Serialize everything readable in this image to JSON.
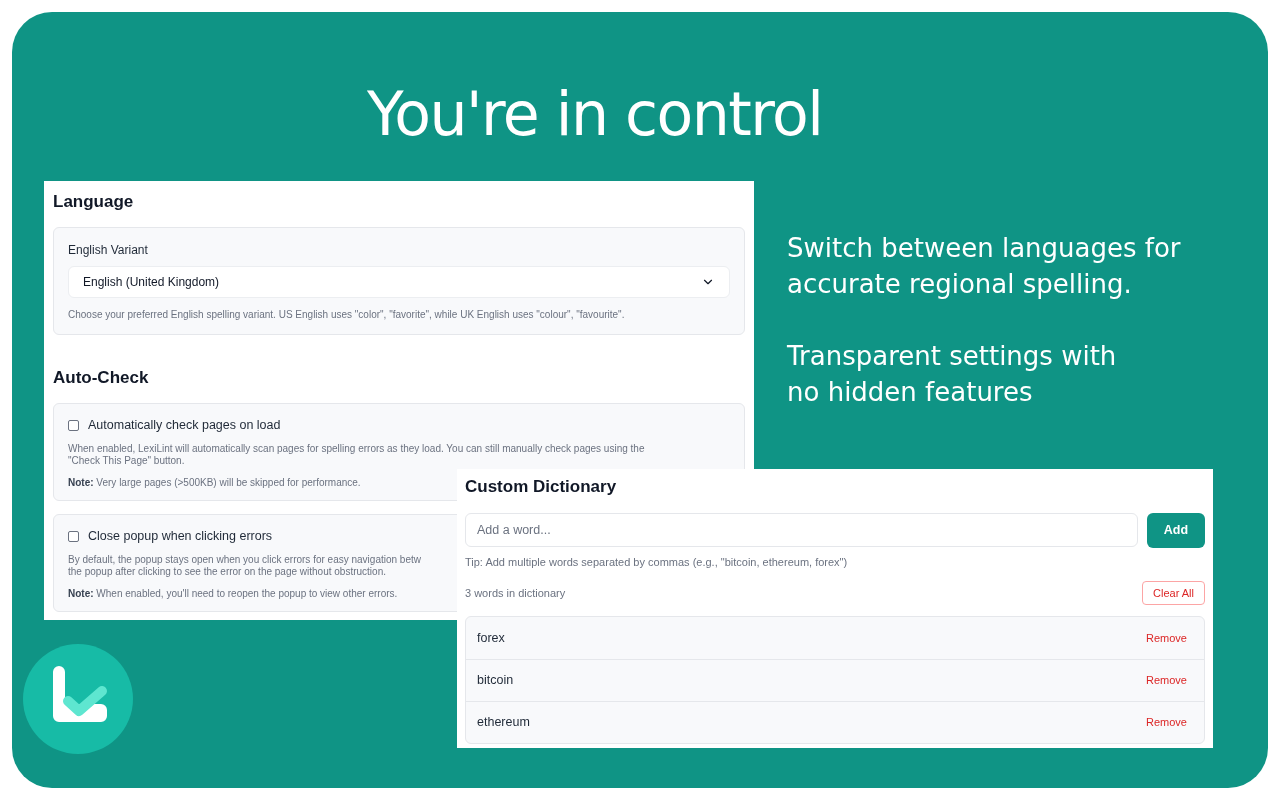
{
  "headline": "You're in control",
  "taglines": [
    {
      "lines": [
        "Switch between languages for",
        "accurate regional spelling."
      ]
    },
    {
      "lines": [
        "Transparent settings with",
        "no hidden features"
      ]
    }
  ],
  "settings_panel": {
    "language": {
      "heading": "Language",
      "label": "English Variant",
      "value": "English (United Kingdom)",
      "help": "Choose your preferred English spelling variant. US English uses \"color\", \"favorite\", while UK English uses \"colour\", \"favourite\"."
    },
    "auto_check": {
      "heading": "Auto-Check",
      "options": [
        {
          "label": "Automatically check pages on load",
          "checked": false,
          "description_lines": [
            "When enabled, LexiLint will automatically scan pages for spelling errors as they load. You can still manually check pages using the",
            "\"Check This Page\" button."
          ],
          "note": "**Note:** Very large pages (>500KB) will be skipped for performance."
        },
        {
          "label": "Close popup when clicking errors",
          "checked": false,
          "description_lines": [
            "By default, the popup stays open when you click errors for easy navigation betw",
            "the popup after clicking to see the error on the page without obstruction."
          ],
          "note": "**Note:** When enabled, you'll need to reopen the popup to view other errors."
        }
      ]
    }
  },
  "dictionary_panel": {
    "heading": "Custom Dictionary",
    "input": {
      "placeholder": "Add a word..."
    },
    "add_button": "Add",
    "tip": "Tip: Add multiple words separated by commas (e.g., \"bitcoin, ethereum, forex\")",
    "count": "3 words in dictionary",
    "clear_button": "Clear All",
    "words": [
      {
        "word": "forex",
        "action": "Remove"
      },
      {
        "word": "bitcoin",
        "action": "Remove"
      },
      {
        "word": "ethereum",
        "action": "Remove"
      }
    ]
  }
}
